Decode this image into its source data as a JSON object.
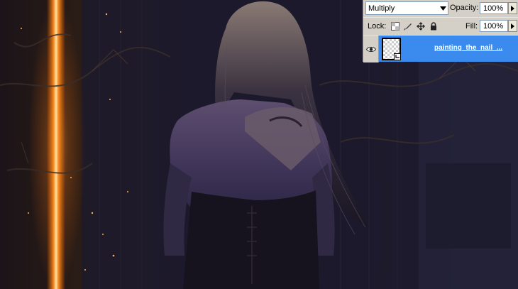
{
  "layers_panel": {
    "blend_mode": "Multiply",
    "opacity_label": "Opacity:",
    "opacity_value": "100%",
    "lock_label": "Lock:",
    "fill_label": "Fill:",
    "fill_value": "100%",
    "lock_icons": [
      "lock-transparent-pixels-icon",
      "lock-image-pixels-icon",
      "lock-position-icon",
      "lock-all-icon"
    ],
    "layer": {
      "name": "painting_the_nail_...",
      "visible": true,
      "clipped": true
    }
  },
  "colors": {
    "panel_bg": "#d4d0c8",
    "selected_layer": "#3b8bef",
    "glow_orange": "#ff8a1a",
    "scene_bg": "#171630"
  }
}
